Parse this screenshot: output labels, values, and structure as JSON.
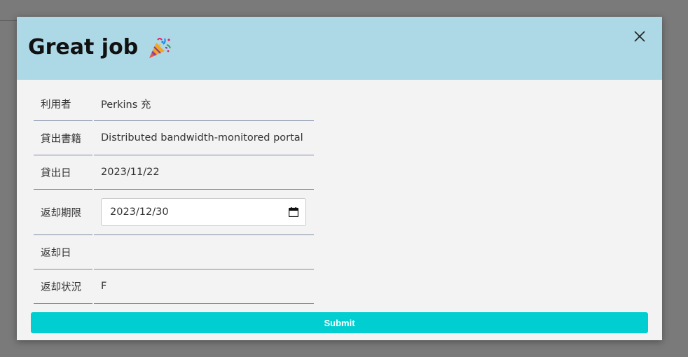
{
  "modal": {
    "title": "Great job",
    "title_icon": "party-popper-icon",
    "close_icon": "close-icon"
  },
  "details": [
    {
      "label": "利用者",
      "value": "Perkins 充"
    },
    {
      "label": "貸出書籍",
      "value": "Distributed bandwidth-monitored portal"
    },
    {
      "label": "貸出日",
      "value": "2023/11/22"
    },
    {
      "label": "返却期限",
      "value": "2023/12/30",
      "type": "date-input",
      "icon": "calendar-icon"
    },
    {
      "label": "返却日",
      "value": ""
    },
    {
      "label": "返却状況",
      "value": "F"
    }
  ],
  "actions": {
    "submit_label": "Submit"
  },
  "colors": {
    "header_bg": "#add8e6",
    "body_bg": "#f3f3f3",
    "submit_bg": "#00ced1",
    "backdrop": "#7a7a7a"
  }
}
